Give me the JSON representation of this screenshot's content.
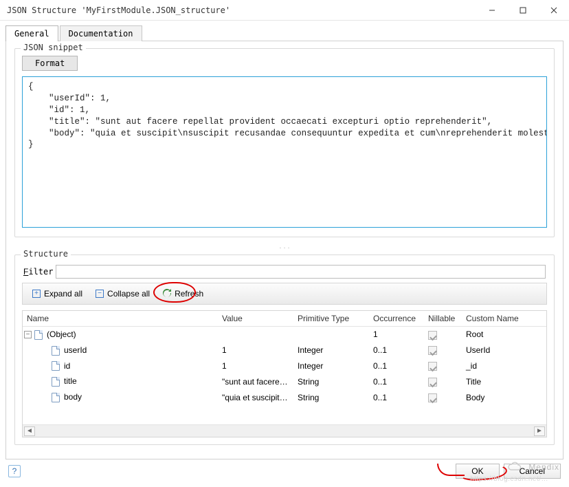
{
  "window": {
    "title": "JSON Structure 'MyFirstModule.JSON_structure'"
  },
  "tabs": {
    "general": "General",
    "documentation": "Documentation",
    "active": "general"
  },
  "snippet_group": {
    "legend": "JSON snippet",
    "format_btn": "Format",
    "json_text": "{\n    \"userId\": 1,\n    \"id\": 1,\n    \"title\": \"sunt aut facere repellat provident occaecati excepturi optio reprehenderit\",\n    \"body\": \"quia et suscipit\\nsuscipit recusandae consequuntur expedita et cum\\nreprehenderit molestiae ut ut quas \\t\\ttotam\\nnostrum rerum est autem sunt rem eveniet architecto\"\n}"
  },
  "structure_group": {
    "legend": "Structure",
    "filter_label": "Filter",
    "filter_value": "",
    "expand_all": "Expand all",
    "collapse_all": "Collapse all",
    "refresh": "Refresh",
    "columns": {
      "name": "Name",
      "value": "Value",
      "ptype": "Primitive Type",
      "occurrence": "Occurrence",
      "nillable": "Nillable",
      "custom_name": "Custom Name"
    },
    "rows": [
      {
        "indent": 0,
        "expander": true,
        "name": "(Object)",
        "value": "",
        "ptype": "",
        "occ": "1",
        "nil": true,
        "cust": "Root"
      },
      {
        "indent": 1,
        "name": "userId",
        "value": "1",
        "ptype": "Integer",
        "occ": "0..1",
        "nil": true,
        "cust": "UserId"
      },
      {
        "indent": 1,
        "name": "id",
        "value": "1",
        "ptype": "Integer",
        "occ": "0..1",
        "nil": true,
        "cust": "_id"
      },
      {
        "indent": 1,
        "name": "title",
        "value": "\"sunt aut facere re...",
        "ptype": "String",
        "occ": "0..1",
        "nil": true,
        "cust": "Title"
      },
      {
        "indent": 1,
        "name": "body",
        "value": "\"quia et suscipit\\ns...",
        "ptype": "String",
        "occ": "0..1",
        "nil": true,
        "cust": "Body"
      }
    ]
  },
  "footer": {
    "ok": "OK",
    "cancel": "Cancel"
  },
  "watermark": "Mendix"
}
